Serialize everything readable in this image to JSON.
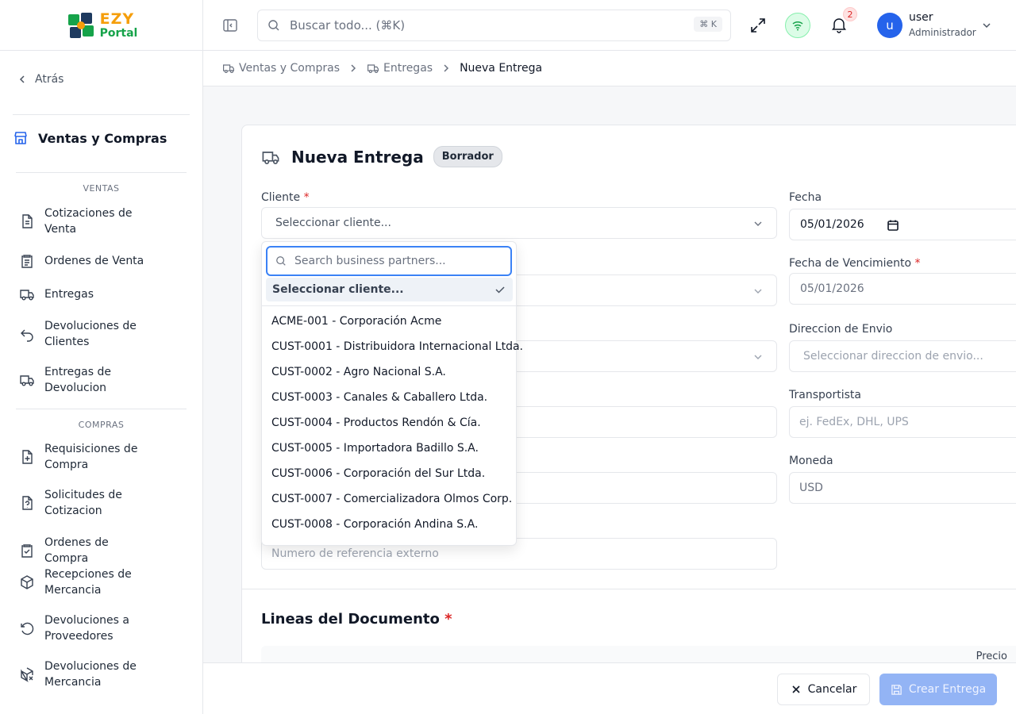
{
  "brand": {
    "line1": "EZY",
    "line2": "Portal"
  },
  "sidebar": {
    "back_label": "Atrás",
    "module_label": "Ventas y Compras",
    "sections": [
      {
        "label": "VENTAS",
        "items": [
          {
            "label": "Cotizaciones de Venta",
            "icon": "file-text-icon"
          },
          {
            "label": "Ordenes de Venta",
            "icon": "clipboard-list-icon"
          },
          {
            "label": "Entregas",
            "icon": "truck-icon"
          },
          {
            "label": "Devoluciones de Clientes",
            "icon": "undo-arrow-icon"
          },
          {
            "label": "Entregas de Devolucion",
            "icon": "truck-return-icon"
          }
        ]
      },
      {
        "label": "COMPRAS",
        "items": [
          {
            "label": "Requisiciones de Compra",
            "icon": "file-plus-icon"
          },
          {
            "label": "Solicitudes de Cotizacion",
            "icon": "file-question-icon"
          },
          {
            "label": "Ordenes de Compra",
            "icon": "clipboard-check-icon"
          },
          {
            "label": "Recepciones de Mercancia",
            "icon": "package-check-icon"
          },
          {
            "label": "Devoluciones a Proveedores",
            "icon": "rotate-ccw-icon"
          },
          {
            "label": "Devoluciones de Mercancia",
            "icon": "package-x-icon"
          }
        ]
      }
    ]
  },
  "topbar": {
    "search_placeholder": "Buscar todo... (⌘K)",
    "search_shortcut": "⌘ K",
    "notifications_count": "2",
    "user": {
      "initial": "u",
      "name": "user",
      "role": "Administrador"
    }
  },
  "breadcrumb": [
    {
      "label": "Ventas y Compras"
    },
    {
      "label": "Entregas"
    },
    {
      "label": "Nueva Entrega"
    }
  ],
  "form": {
    "title": "Nueva Entrega",
    "status": "Borrador",
    "cliente_label": "Cliente",
    "cliente_placeholder": "Seleccionar cliente...",
    "fecha_label": "Fecha",
    "fecha_value": "05/01/2026",
    "vencimiento_label": "Fecha de Vencimiento",
    "vencimiento_value": "05/01/2026",
    "direccion_label": "Direccion de Envio",
    "direccion_placeholder": "Seleccionar direccion de envio...",
    "transportista_label": "Transportista",
    "transportista_placeholder": "ej. FedEx, DHL, UPS",
    "moneda_label": "Moneda",
    "moneda_value": "USD",
    "referencia_placeholder": "Numero de referencia externo",
    "required_mark": "*",
    "lines_title": "Lineas del Documento",
    "lines_price_header": "Precio"
  },
  "dropdown": {
    "search_placeholder": "Search business partners...",
    "selected": "Seleccionar cliente...",
    "options": [
      "ACME-001 - Corporación Acme",
      "CUST-0001 - Distribuidora Internacional Ltda.",
      "CUST-0002 - Agro Nacional S.A.",
      "CUST-0003 - Canales & Caballero Ltda.",
      "CUST-0004 - Productos Rendón & Cía.",
      "CUST-0005 - Importadora Badillo S.A.",
      "CUST-0006 - Corporación del Sur Ltda.",
      "CUST-0007 - Comercializadora Olmos Corp.",
      "CUST-0008 - Corporación Andina S.A."
    ]
  },
  "footer": {
    "cancel_label": "Cancelar",
    "create_label": "Crear Entrega"
  },
  "colors": {
    "primary": "#2563eb",
    "primary_disabled": "#93b4f5",
    "required": "#dc2626",
    "logo_orange": "#f59e0b",
    "logo_green": "#16a34a"
  }
}
